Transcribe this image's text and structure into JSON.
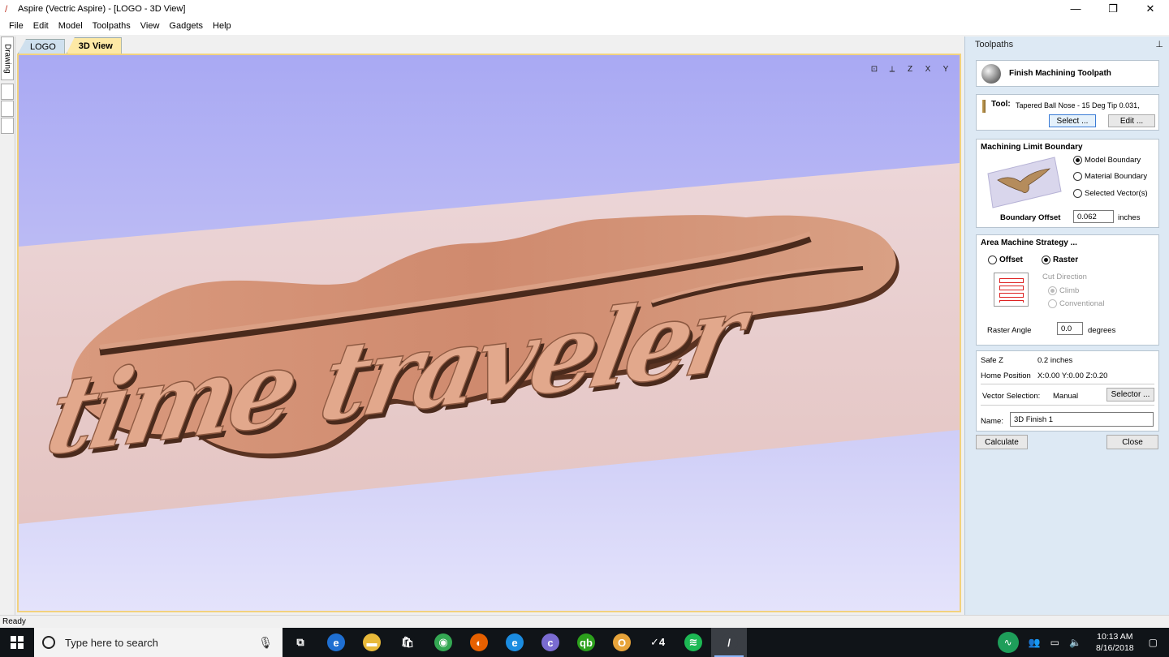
{
  "window": {
    "title": "Aspire (Vectric Aspire) - [LOGO - 3D View]",
    "controls": [
      "—",
      "❐",
      "✕"
    ]
  },
  "menu": [
    "File",
    "Edit",
    "Model",
    "Toolpaths",
    "View",
    "Gadgets",
    "Help"
  ],
  "left_strip": {
    "drawing_tab": "Drawing"
  },
  "doc_tabs": [
    {
      "label": "LOGO",
      "active": false
    },
    {
      "label": "3D View",
      "active": true
    }
  ],
  "viewport": {
    "carving_text": "time traveler",
    "view_icons": [
      "fit-view-icon",
      "iso-view-icon",
      "top-view-icon",
      "front-view-icon",
      "side-view-icon"
    ],
    "colors": {
      "sky_top": "#a9a9f3",
      "material": "#e8c9c4",
      "wood": "#cf8d73",
      "shadow": "#4a2a1c"
    }
  },
  "panel": {
    "title": "Toolpaths",
    "pin": "⊥",
    "header_title": "Finish Machining Toolpath",
    "tool": {
      "label": "Tool:",
      "name": "Tapered Ball Nose - 15 Deg Tip 0.031,",
      "select_label": "Select ...",
      "edit_label": "Edit ..."
    },
    "boundary": {
      "title": "Machining Limit Boundary",
      "options": [
        {
          "label": "Model Boundary",
          "selected": true
        },
        {
          "label": "Material Boundary",
          "selected": false
        },
        {
          "label": "Selected Vector(s)",
          "selected": false
        }
      ],
      "offset_label": "Boundary Offset",
      "offset_value": "0.062",
      "offset_unit": "inches"
    },
    "strategy": {
      "title": "Area Machine Strategy ...",
      "offset_label": "Offset",
      "raster_label": "Raster",
      "cut_direction_label": "Cut Direction",
      "climb_label": "Climb",
      "conventional_label": "Conventional",
      "raster_angle_label": "Raster Angle",
      "raster_angle_value": "0.0",
      "raster_angle_unit": "degrees"
    },
    "settings": {
      "safe_z_label": "Safe Z",
      "safe_z_value": "0.2 inches",
      "home_label": "Home Position",
      "home_value": "X:0.00 Y:0.00 Z:0.20",
      "vector_sel_label": "Vector Selection:",
      "vector_sel_value": "Manual",
      "selector_label": "Selector ...",
      "name_label": "Name:",
      "name_value": "3D Finish 1"
    },
    "calculate_label": "Calculate",
    "close_label": "Close"
  },
  "status": "Ready",
  "taskbar": {
    "search_placeholder": "Type here to search",
    "apps": [
      {
        "name": "task-view-icon",
        "glyph": "⧉",
        "color": "#101418"
      },
      {
        "name": "edge-icon",
        "glyph": "e",
        "color": "#1f6fd1"
      },
      {
        "name": "file-explorer-icon",
        "glyph": "▬",
        "color": "#e8b93a"
      },
      {
        "name": "store-icon",
        "glyph": "🛍",
        "color": "#101418"
      },
      {
        "name": "chrome-icon",
        "glyph": "◉",
        "color": "#34a853"
      },
      {
        "name": "firefox-icon",
        "glyph": "◐",
        "color": "#e66000"
      },
      {
        "name": "ie-icon",
        "glyph": "e",
        "color": "#1b8ce0"
      },
      {
        "name": "app-c-icon",
        "glyph": "c",
        "color": "#7a6bd1"
      },
      {
        "name": "quickbooks-icon",
        "glyph": "qb",
        "color": "#2ca01c"
      },
      {
        "name": "outlook-icon",
        "glyph": "O",
        "color": "#e7a33a"
      },
      {
        "name": "tasks-icon",
        "glyph": "✓4",
        "color": "#101418"
      },
      {
        "name": "spotify-icon",
        "glyph": "≋",
        "color": "#1db954"
      },
      {
        "name": "aspire-icon",
        "glyph": "/",
        "color": "#3b3f45"
      }
    ],
    "time": "10:13 AM",
    "date": "8/16/2018"
  }
}
